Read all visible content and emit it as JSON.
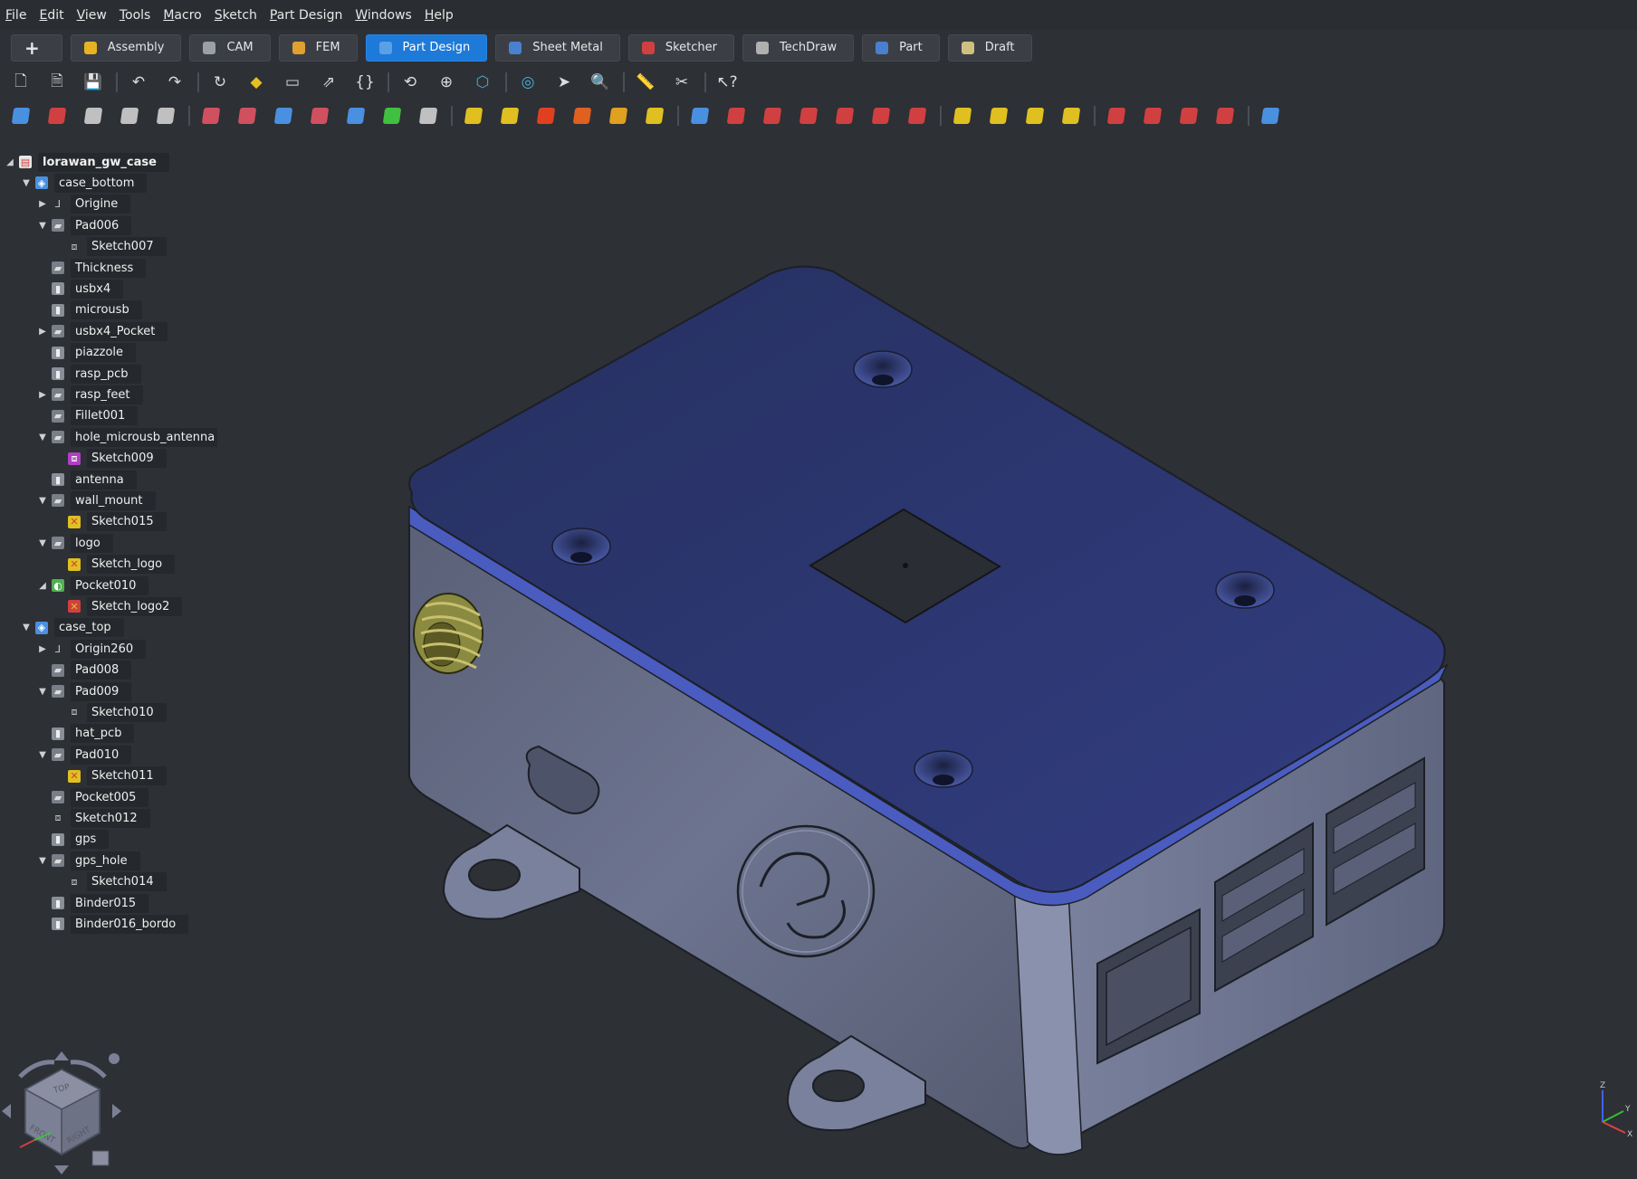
{
  "menu": [
    "File",
    "Edit",
    "View",
    "Tools",
    "Macro",
    "Sketch",
    "Part Design",
    "Windows",
    "Help"
  ],
  "workbenches": {
    "plus": "+",
    "items": [
      {
        "label": "Assembly",
        "color": "#e6b422"
      },
      {
        "label": "CAM",
        "color": "#9aa0a6"
      },
      {
        "label": "FEM",
        "color": "#e0a030"
      },
      {
        "label": "Part Design",
        "color": "#5aa0e8",
        "active": true
      },
      {
        "label": "Sheet Metal",
        "color": "#4a80d0"
      },
      {
        "label": "Sketcher",
        "color": "#d04040"
      },
      {
        "label": "TechDraw",
        "color": "#b0b0b0"
      },
      {
        "label": "Part",
        "color": "#4a7fd0"
      },
      {
        "label": "Draft",
        "color": "#d0c080"
      }
    ]
  },
  "toolbar1": [
    "new-document-icon",
    "open-icon",
    "save-icon",
    "|",
    "undo-icon",
    "redo-icon",
    "|",
    "refresh-icon",
    "macro-icon",
    "folder-icon",
    "export-icon",
    "braces-icon",
    "|",
    "fit-all-icon",
    "fit-selection-icon",
    "isometric-view-icon",
    "|",
    "draw-style-icon",
    "selection-icon",
    "zoom-icon",
    "|",
    "measure-icon",
    "clipping-icon",
    "|",
    "whats-this-icon"
  ],
  "toolbar2_count": 34,
  "tree": {
    "items": [
      {
        "label": "lorawan_gw_case",
        "depth": 0,
        "arrow": "◢",
        "icon": "doc",
        "root": true
      },
      {
        "label": "case_bottom",
        "depth": 1,
        "arrow": "▼",
        "icon": "body"
      },
      {
        "label": "Origine",
        "depth": 2,
        "arrow": "▶",
        "icon": "origin"
      },
      {
        "label": "Pad006",
        "depth": 2,
        "arrow": "▼",
        "icon": "feat"
      },
      {
        "label": "Sketch007",
        "depth": 3,
        "arrow": "",
        "icon": "sketch"
      },
      {
        "label": "Thickness",
        "depth": 2,
        "arrow": "",
        "icon": "feat"
      },
      {
        "label": "usbx4",
        "depth": 2,
        "arrow": "",
        "icon": "binder"
      },
      {
        "label": "microusb",
        "depth": 2,
        "arrow": "",
        "icon": "binder"
      },
      {
        "label": "usbx4_Pocket",
        "depth": 2,
        "arrow": "▶",
        "icon": "feat"
      },
      {
        "label": "piazzole",
        "depth": 2,
        "arrow": "",
        "icon": "binder"
      },
      {
        "label": "rasp_pcb",
        "depth": 2,
        "arrow": "",
        "icon": "binder"
      },
      {
        "label": "rasp_feet",
        "depth": 2,
        "arrow": "▶",
        "icon": "feat"
      },
      {
        "label": "Fillet001",
        "depth": 2,
        "arrow": "",
        "icon": "feat"
      },
      {
        "label": "hole_microusb_antenna",
        "depth": 2,
        "arrow": "▼",
        "icon": "feat"
      },
      {
        "label": "Sketch009",
        "depth": 3,
        "arrow": "",
        "icon": "sketch-purple"
      },
      {
        "label": "antenna",
        "depth": 2,
        "arrow": "",
        "icon": "binder"
      },
      {
        "label": "wall_mount",
        "depth": 2,
        "arrow": "▼",
        "icon": "feat"
      },
      {
        "label": "Sketch015",
        "depth": 3,
        "arrow": "",
        "icon": "sketch-yellow"
      },
      {
        "label": "logo",
        "depth": 2,
        "arrow": "▼",
        "icon": "feat"
      },
      {
        "label": "Sketch_logo",
        "depth": 3,
        "arrow": "",
        "icon": "sketch-yellow"
      },
      {
        "label": "Pocket010",
        "depth": 2,
        "arrow": "◢",
        "icon": "pocket-green"
      },
      {
        "label": "Sketch_logo2",
        "depth": 3,
        "arrow": "",
        "icon": "sketch-red"
      },
      {
        "label": "case_top",
        "depth": 1,
        "arrow": "▼",
        "icon": "body"
      },
      {
        "label": "Origin260",
        "depth": 2,
        "arrow": "▶",
        "icon": "origin"
      },
      {
        "label": "Pad008",
        "depth": 2,
        "arrow": "",
        "icon": "feat"
      },
      {
        "label": "Pad009",
        "depth": 2,
        "arrow": "▼",
        "icon": "feat"
      },
      {
        "label": "Sketch010",
        "depth": 3,
        "arrow": "",
        "icon": "sketch"
      },
      {
        "label": "hat_pcb",
        "depth": 2,
        "arrow": "",
        "icon": "binder"
      },
      {
        "label": "Pad010",
        "depth": 2,
        "arrow": "▼",
        "icon": "feat"
      },
      {
        "label": "Sketch011",
        "depth": 3,
        "arrow": "",
        "icon": "sketch-yellow"
      },
      {
        "label": "Pocket005",
        "depth": 2,
        "arrow": "",
        "icon": "feat"
      },
      {
        "label": "Sketch012",
        "depth": 2,
        "arrow": "",
        "icon": "sketch"
      },
      {
        "label": "gps",
        "depth": 2,
        "arrow": "",
        "icon": "binder"
      },
      {
        "label": "gps_hole",
        "depth": 2,
        "arrow": "▼",
        "icon": "feat"
      },
      {
        "label": "Sketch014",
        "depth": 3,
        "arrow": "",
        "icon": "sketch"
      },
      {
        "label": "Binder015",
        "depth": 2,
        "arrow": "",
        "icon": "binder"
      },
      {
        "label": "Binder016_bordo",
        "depth": 2,
        "arrow": "",
        "icon": "binder"
      }
    ]
  },
  "navcube": {
    "top": "TOP",
    "front": "FRONT",
    "right": "RIGHT"
  },
  "axis": {
    "x": "X",
    "y": "Y",
    "z": "Z"
  },
  "colors": {
    "accent": "#1e7ad8",
    "case_top": "#2f3a78",
    "case_body": "#6f7690",
    "background": "#2d3035"
  }
}
